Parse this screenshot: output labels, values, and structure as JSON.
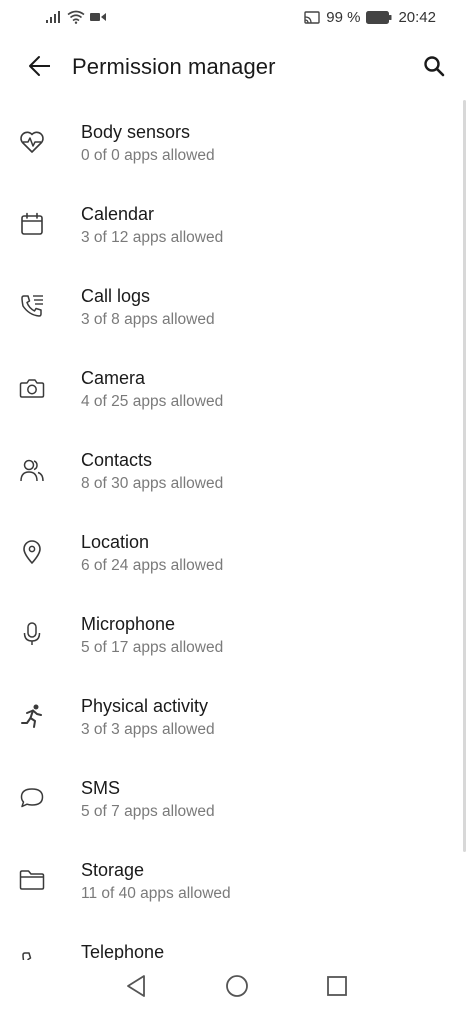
{
  "status_bar": {
    "battery_percent": "99 %",
    "time": "20:42",
    "icons": [
      "signal-icon",
      "wifi-icon",
      "video-icon",
      "cast-icon",
      "battery-icon"
    ]
  },
  "app_bar": {
    "title": "Permission manager",
    "icons": [
      "back-arrow-icon",
      "search-icon"
    ]
  },
  "permissions": [
    {
      "icon": "heart-pulse-icon",
      "label": "Body sensors",
      "sub": "0 of 0 apps allowed"
    },
    {
      "icon": "calendar-icon",
      "label": "Calendar",
      "sub": "3 of 12 apps allowed"
    },
    {
      "icon": "call-log-icon",
      "label": "Call logs",
      "sub": "3 of 8 apps allowed"
    },
    {
      "icon": "camera-icon",
      "label": "Camera",
      "sub": "4 of 25 apps allowed"
    },
    {
      "icon": "contacts-icon",
      "label": "Contacts",
      "sub": "8 of 30 apps allowed"
    },
    {
      "icon": "location-pin-icon",
      "label": "Location",
      "sub": "6 of 24 apps allowed"
    },
    {
      "icon": "microphone-icon",
      "label": "Microphone",
      "sub": "5 of 17 apps allowed"
    },
    {
      "icon": "running-person-icon",
      "label": "Physical activity",
      "sub": "3 of 3 apps allowed"
    },
    {
      "icon": "chat-bubble-icon",
      "label": "SMS",
      "sub": "5 of 7 apps allowed"
    },
    {
      "icon": "folder-icon",
      "label": "Storage",
      "sub": "11 of 40 apps allowed"
    },
    {
      "icon": "phone-icon",
      "label": "Telephone",
      "sub": ""
    }
  ],
  "nav_bar": {
    "icons": [
      "back-triangle-icon",
      "home-circle-icon",
      "recents-square-icon"
    ]
  },
  "colors": {
    "background": "#ffffff",
    "primary_text": "#1a1a1a",
    "secondary_text": "#7a7a7a",
    "icon": "#3a3a3a"
  }
}
